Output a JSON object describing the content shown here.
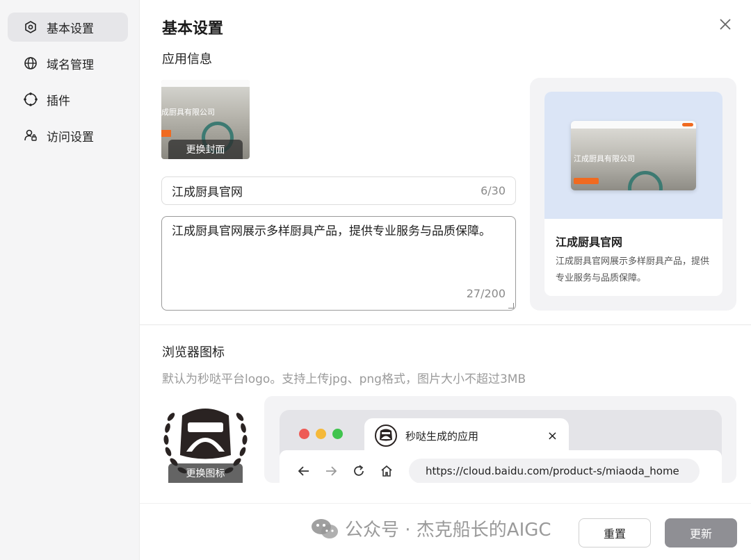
{
  "sidebar": {
    "items": [
      {
        "label": "基本设置",
        "icon": "settings-icon",
        "active": true
      },
      {
        "label": "域名管理",
        "icon": "globe-icon",
        "active": false
      },
      {
        "label": "插件",
        "icon": "plugin-icon",
        "active": false
      },
      {
        "label": "访问设置",
        "icon": "user-lock-icon",
        "active": false
      }
    ]
  },
  "header": {
    "title": "基本设置"
  },
  "app_info": {
    "section_title": "应用信息",
    "cover_button": "更换封面",
    "cover_preview_headline": "成厨具有限公司",
    "name_value": "江成厨具官网",
    "name_count": "6/30",
    "desc_value": "江成厨具官网展示多样厨具产品，提供专业服务与品质保障。",
    "desc_count": "27/200"
  },
  "preview": {
    "shot_headline": "江成厨具有限公司",
    "name": "江成厨具官网",
    "desc": "江成厨具官网展示多样厨具产品，提供专业服务与品质保障。"
  },
  "browser_icon": {
    "section_title": "浏览器图标",
    "hint": "默认为秒哒平台logo。支持上传jpg、png格式，图片大小不超过3MB",
    "icon_button": "更换图标",
    "tab_title": "秒哒生成的应用",
    "tab_close": "×",
    "url": "https://cloud.baidu.com/product-s/miaoda_home"
  },
  "footer": {
    "reset_label": "重置",
    "update_label": "更新"
  },
  "watermark": {
    "text": "公众号 · 杰克船长的AIGC"
  },
  "colors": {
    "accent_orange": "#f06a20",
    "preview_bg": "#dbe5f6",
    "update_btn": "#8f8f94",
    "traffic_red": "#ee5a55",
    "traffic_yellow": "#f5b93a",
    "traffic_green": "#40c44e"
  }
}
